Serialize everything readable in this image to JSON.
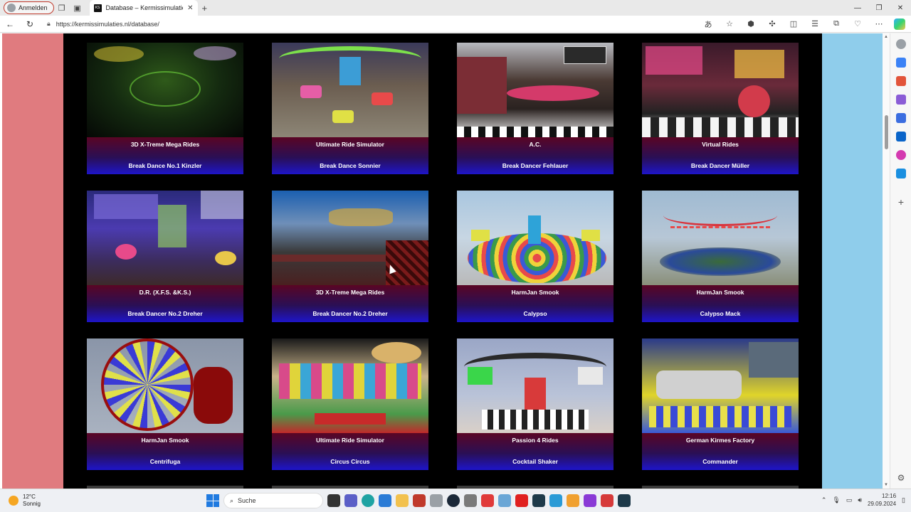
{
  "browser": {
    "profile_label": "Anmelden",
    "tab_title": "Database – Kermissimulaties.nl",
    "favicon_text": "KS",
    "url": "https://kermissimulaties.nl/database/"
  },
  "cards": [
    {
      "maker": "3D X-Treme Mega Rides",
      "ride": "Break Dance No.1 Kinzler"
    },
    {
      "maker": "Ultimate Ride Simulator",
      "ride": "Break Dance Sonnier"
    },
    {
      "maker": "A.C.",
      "ride": "Break Dancer Fehlauer"
    },
    {
      "maker": "Virtual Rides",
      "ride": "Break Dancer Müller"
    },
    {
      "maker": "D.R. (X.F.S. &K.S.)",
      "ride": "Break Dancer No.2 Dreher"
    },
    {
      "maker": "3D X-Treme Mega Rides",
      "ride": "Break Dancer No.2 Dreher"
    },
    {
      "maker": "HarmJan Smook",
      "ride": "Calypso"
    },
    {
      "maker": "HarmJan Smook",
      "ride": "Calypso Mack"
    },
    {
      "maker": "HarmJan Smook",
      "ride": "Centrifuga"
    },
    {
      "maker": "Ultimate Ride Simulator",
      "ride": "Circus Circus"
    },
    {
      "maker": "Passion 4 Rides",
      "ride": "Cocktail Shaker"
    },
    {
      "maker": "German Kirmes Factory",
      "ride": "Commander"
    }
  ],
  "taskbar": {
    "temperature": "12°C",
    "weather": "Sonnig",
    "search_placeholder": "Suche",
    "time": "12:16",
    "date": "29.09.2024"
  },
  "colors": {
    "left_panel": "#e07b7f",
    "right_panel": "#8fcdeb",
    "caption_top": "#5a0524",
    "caption_bottom": "#1e15c9"
  }
}
